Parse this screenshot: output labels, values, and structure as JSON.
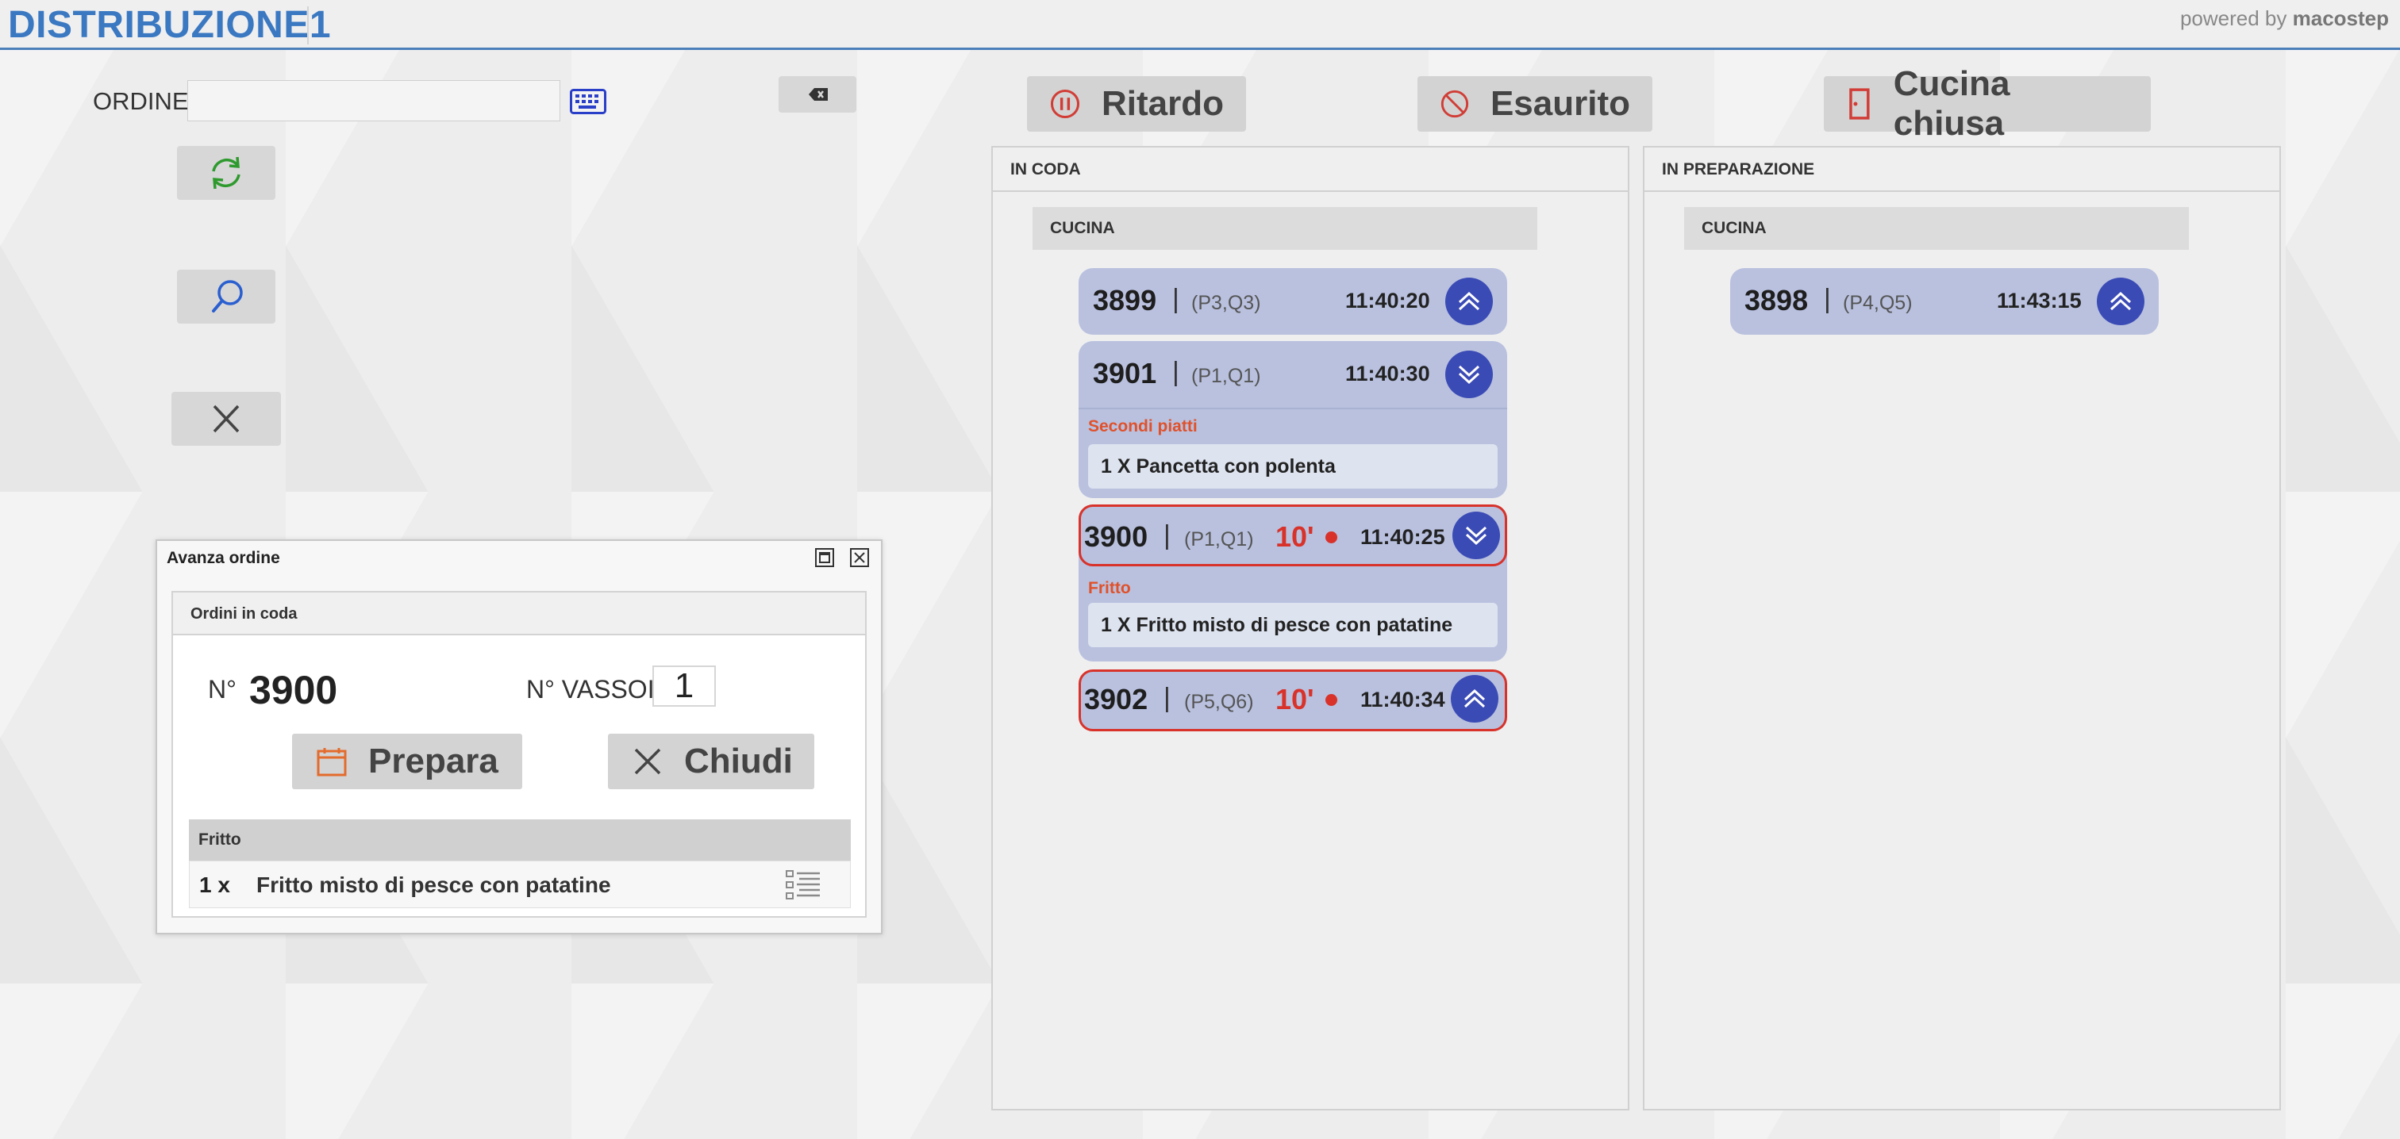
{
  "app": {
    "title": "DISTRIBUZIONE1",
    "powered_prefix": "powered by ",
    "powered_brand": "macostep"
  },
  "order_entry": {
    "label": "ORDINE",
    "value": "",
    "placeholder": ""
  },
  "actions": {
    "delay": "Ritardo",
    "sold_out": "Esaurito",
    "kitchen_closed": "Cucina chiusa"
  },
  "colors": {
    "brand": "#3a78c2",
    "card": "#b9c1df",
    "circle_button": "#3b4bb5",
    "alert": "#d8322a",
    "category": "#e0512a"
  },
  "queue_panel": {
    "title": "IN CODA",
    "section": "CUCINA",
    "orders": [
      {
        "number": "3899",
        "tables": "(P3,Q3)",
        "time": "11:40:20",
        "toggle": "expand-up"
      },
      {
        "number": "3901",
        "tables": "(P1,Q1)",
        "time": "11:40:30",
        "toggle": "collapse-down",
        "category": "Secondi piatti",
        "item": "1 X  Pancetta con polenta"
      },
      {
        "number": "3900",
        "tables": "(P1,Q1)",
        "delay": "10'",
        "time": "11:40:25",
        "toggle": "collapse-down",
        "category": "Fritto",
        "item": "1 X  Fritto misto di pesce con patatine"
      },
      {
        "number": "3902",
        "tables": "(P5,Q6)",
        "delay": "10'",
        "time": "11:40:34",
        "toggle": "expand-up"
      }
    ]
  },
  "prep_panel": {
    "title": "IN PREPARAZIONE",
    "section": "CUCINA",
    "orders": [
      {
        "number": "3898",
        "tables": "(P4,Q5)",
        "time": "11:43:15",
        "toggle": "expand-up"
      }
    ]
  },
  "dialog": {
    "title": "Avanza ordine",
    "section": "Ordini in coda",
    "number_label": "N°",
    "number_value": "3900",
    "trays_label": "N° VASSOI",
    "trays_value": "1",
    "prepare_label": "Prepara",
    "close_label": "Chiudi",
    "table": {
      "category": "Fritto",
      "rows": [
        {
          "qty": "1 x",
          "name": "Fritto misto di pesce con patatine"
        }
      ]
    }
  },
  "separator": "|"
}
